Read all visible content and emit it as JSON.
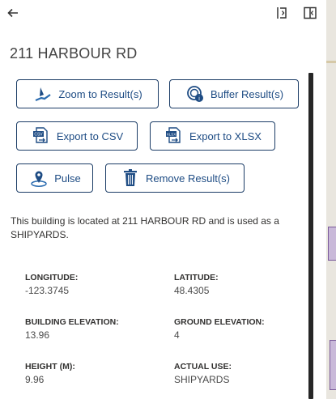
{
  "header": {
    "back_icon": "arrow-left-icon",
    "dock_icon": "dock-panel-icon",
    "split_icon": "split-view-icon"
  },
  "title": "211 HARBOUR RD",
  "actions": {
    "zoom": {
      "label": "Zoom to Result(s)",
      "icon": "zoom-icon"
    },
    "buffer": {
      "label": "Buffer Result(s)",
      "icon": "buffer-icon"
    },
    "csv": {
      "label": "Export to CSV",
      "icon": "csv-export-icon"
    },
    "xlsx": {
      "label": "Export to XLSX",
      "icon": "xlsx-export-icon"
    },
    "pulse": {
      "label": "Pulse",
      "icon": "pulse-pin-icon"
    },
    "remove": {
      "label": "Remove Result(s)",
      "icon": "trash-icon"
    }
  },
  "description": "This building is located at 211 HARBOUR RD and is used as a SHIPYARDS.",
  "attributes": [
    {
      "label": "LONGITUDE:",
      "value": "-123.3745"
    },
    {
      "label": "LATITUDE:",
      "value": "48.4305"
    },
    {
      "label": "BUILDING ELEVATION:",
      "value": "13.96"
    },
    {
      "label": "GROUND ELEVATION:",
      "value": "4"
    },
    {
      "label": "HEIGHT (M):",
      "value": "9.96"
    },
    {
      "label": "ACTUAL USE:",
      "value": "SHIPYARDS"
    }
  ],
  "colors": {
    "accent": "#1e4c84",
    "border": "#1b3c66",
    "scrollbar": "#262626"
  }
}
